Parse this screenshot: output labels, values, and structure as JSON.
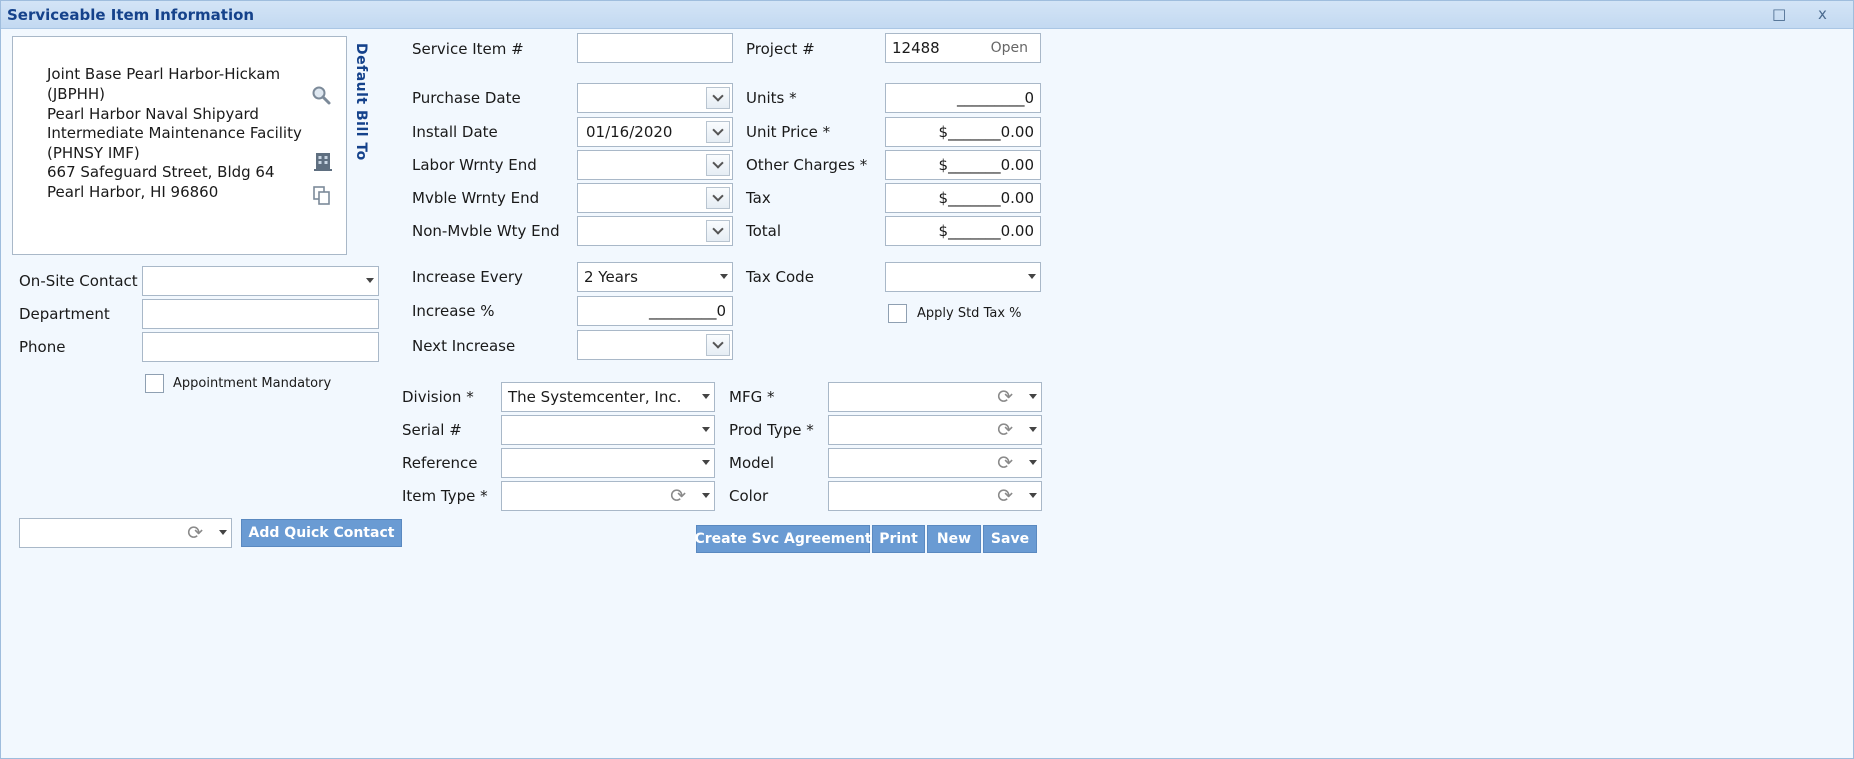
{
  "window": {
    "title": "Serviceable Item Information",
    "maximize_glyph": "□",
    "close_glyph": "x"
  },
  "address": {
    "lines": [
      "Joint Base Pearl Harbor-Hickam",
      "(JBPHH)",
      "Pearl Harbor Naval Shipyard",
      "Intermediate Maintenance Facility",
      "(PHNSY  IMF)",
      "667 Safeguard Street, Bldg 64",
      "Pearl Harbor, HI 96860"
    ],
    "icons": [
      "search-icon",
      "building-icon",
      "copy-icon"
    ],
    "side_label": "Default Bill To"
  },
  "contact": {
    "onsite_label": "On-Site Contact",
    "onsite_value": "",
    "department_label": "Department",
    "department_value": "",
    "phone_label": "Phone",
    "phone_value": "",
    "appointment_label": "Appointment Mandatory",
    "appointment_checked": false
  },
  "service": {
    "item_label": "Service Item #",
    "item_value": "",
    "purchase_label": "Purchase Date",
    "purchase_value": "",
    "install_label": "Install Date",
    "install_value": "01/16/2020",
    "labor_label": "Labor Wrnty End",
    "labor_value": "",
    "mvble_label": "Mvble Wrnty End",
    "mvble_value": "",
    "nonmvble_label": "Non-Mvble Wty End",
    "nonmvble_value": "",
    "increase_every_label": "Increase Every",
    "increase_every_value": "2 Years",
    "increase_pct_label": "Increase %",
    "increase_pct_value": "_________0",
    "next_increase_label": "Next Increase",
    "next_increase_value": ""
  },
  "pricing": {
    "project_label": "Project #",
    "project_value": "12488",
    "project_status": "Open",
    "units_label": "Units *",
    "units_value": "_________0",
    "unit_price_label": "Unit Price *",
    "unit_price_value": "$_______0.00",
    "other_label": "Other Charges *",
    "other_value": "$_______0.00",
    "tax_label": "Tax",
    "tax_value": "$_______0.00",
    "total_label": "Total",
    "total_value": "$_______0.00",
    "tax_code_label": "Tax Code",
    "tax_code_value": "",
    "apply_std_label": "Apply Std Tax %",
    "apply_std_checked": false
  },
  "product": {
    "division_label": "Division *",
    "division_value": "The Systemcenter, Inc.",
    "serial_label": "Serial #",
    "serial_value": "",
    "reference_label": "Reference",
    "reference_value": "",
    "item_type_label": "Item Type *",
    "item_type_value": "",
    "mfg_label": "MFG *",
    "mfg_value": "",
    "prod_type_label": "Prod Type *",
    "prod_type_value": "",
    "model_label": "Model",
    "model_value": "",
    "color_label": "Color",
    "color_value": ""
  },
  "actions": {
    "quick_contact_value": "",
    "add_quick_contact": "Add Quick Contact",
    "create_svc": "Create Svc Agreement",
    "print": "Print",
    "new": "New",
    "save": "Save"
  }
}
